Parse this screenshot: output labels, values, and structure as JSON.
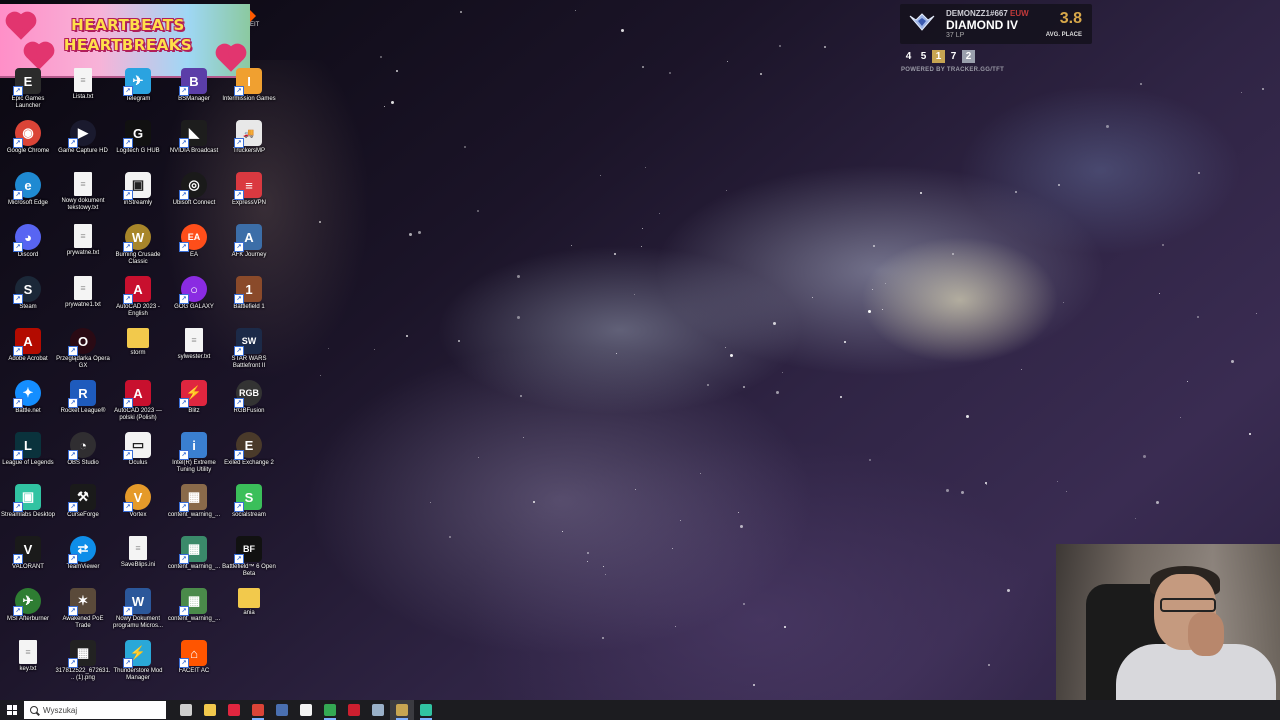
{
  "promo": {
    "line1": "HEARTBEATS",
    "line2": "HEARTBREAKS",
    "side_text": "EIT"
  },
  "desktop_icons": [
    {
      "label": "Epic Games Launcher",
      "color": "#2b2b2b",
      "glyph": "E",
      "kind": "app",
      "col": 0,
      "row": 0
    },
    {
      "label": "Lista.txt",
      "kind": "doc",
      "col": 1,
      "row": 0
    },
    {
      "label": "Telegram",
      "color": "#2aa3e0",
      "glyph": "✈",
      "kind": "app",
      "col": 2,
      "row": 0
    },
    {
      "label": "BSManager",
      "color": "#5b3ea8",
      "glyph": "B",
      "kind": "app",
      "col": 3,
      "row": 0
    },
    {
      "label": "Intermission Games",
      "color": "#f0a030",
      "glyph": "I",
      "kind": "app",
      "col": 4,
      "row": 0
    },
    {
      "label": "Google Chrome",
      "color": "#db4437",
      "glyph": "◉",
      "kind": "round",
      "col": 0,
      "row": 1
    },
    {
      "label": "Game Capture HD",
      "color": "#1a1a2e",
      "glyph": "▶",
      "kind": "round",
      "col": 1,
      "row": 1
    },
    {
      "label": "Logitech G HUB",
      "color": "#111",
      "glyph": "G",
      "kind": "app",
      "col": 2,
      "row": 1
    },
    {
      "label": "NVIDIA Broadcast",
      "color": "#1d1d1d",
      "glyph": "◣",
      "kind": "app",
      "col": 3,
      "row": 1
    },
    {
      "label": "TruckersMP",
      "color": "#e8e8e8",
      "glyph": "🚚",
      "kind": "app",
      "col": 4,
      "row": 1
    },
    {
      "label": "Microsoft Edge",
      "color": "#1f8ad2",
      "glyph": "e",
      "kind": "round",
      "col": 0,
      "row": 2
    },
    {
      "label": "Nowy dokument tekstowy.txt",
      "kind": "doc",
      "col": 1,
      "row": 2
    },
    {
      "label": "inStreamly",
      "color": "#f3f3f3",
      "glyph": "▣",
      "kind": "app",
      "col": 2,
      "row": 2
    },
    {
      "label": "Ubisoft Connect",
      "color": "#1a1a1a",
      "glyph": "◎",
      "kind": "round",
      "col": 3,
      "row": 2
    },
    {
      "label": "ExpressVPN",
      "color": "#da3940",
      "glyph": "≡",
      "kind": "app",
      "col": 4,
      "row": 2
    },
    {
      "label": "Discord",
      "color": "#5865f2",
      "glyph": "◕",
      "kind": "round",
      "col": 0,
      "row": 3
    },
    {
      "label": "prywatne.txt",
      "kind": "doc",
      "col": 1,
      "row": 3
    },
    {
      "label": "Burning Crusade Classic",
      "color": "#a8862a",
      "glyph": "W",
      "kind": "round",
      "col": 2,
      "row": 3
    },
    {
      "label": "EA",
      "color": "#ff4e1a",
      "glyph": "EA",
      "kind": "round",
      "col": 3,
      "row": 3
    },
    {
      "label": "AFK Journey",
      "color": "#3c6ea8",
      "glyph": "A",
      "kind": "app",
      "col": 4,
      "row": 3
    },
    {
      "label": "Steam",
      "color": "#1b2838",
      "glyph": "S",
      "kind": "round",
      "col": 0,
      "row": 4
    },
    {
      "label": "prywatne1.txt",
      "kind": "doc",
      "col": 1,
      "row": 4
    },
    {
      "label": "AutoCAD 2023 - English",
      "color": "#c8102e",
      "glyph": "A",
      "kind": "app",
      "col": 2,
      "row": 4
    },
    {
      "label": "GOG GALAXY",
      "color": "#8a2be2",
      "glyph": "○",
      "kind": "round",
      "col": 3,
      "row": 4
    },
    {
      "label": "Battlefield 1",
      "color": "#8a4a2a",
      "glyph": "1",
      "kind": "app",
      "col": 4,
      "row": 4
    },
    {
      "label": "Adobe Acrobat",
      "color": "#b30b00",
      "glyph": "A",
      "kind": "app",
      "col": 0,
      "row": 5
    },
    {
      "label": "Przeglądarka Opera GX",
      "color": "#2a0a14",
      "glyph": "O",
      "kind": "round",
      "col": 1,
      "row": 5
    },
    {
      "label": "storm",
      "kind": "folder",
      "col": 2,
      "row": 5
    },
    {
      "label": "sylwester.txt",
      "kind": "doc",
      "col": 3,
      "row": 5
    },
    {
      "label": "STAR WARS Battlefront II",
      "color": "#1c2a48",
      "glyph": "SW",
      "kind": "app",
      "col": 4,
      "row": 5
    },
    {
      "label": "Battle.net",
      "color": "#148eff",
      "glyph": "✦",
      "kind": "round",
      "col": 0,
      "row": 6
    },
    {
      "label": "Rocket League®",
      "color": "#1e5bbd",
      "glyph": "R",
      "kind": "app",
      "col": 1,
      "row": 6
    },
    {
      "label": "AutoCAD 2023 — polski (Polish)",
      "color": "#c8102e",
      "glyph": "A",
      "kind": "app",
      "col": 2,
      "row": 6
    },
    {
      "label": "Blitz",
      "color": "#e0263f",
      "glyph": "⚡",
      "kind": "app",
      "col": 3,
      "row": 6
    },
    {
      "label": "RGBFusion",
      "color": "#333",
      "glyph": "RGB",
      "kind": "round",
      "col": 4,
      "row": 6
    },
    {
      "label": "League of Legends",
      "color": "#0a323c",
      "glyph": "L",
      "kind": "app",
      "col": 0,
      "row": 7
    },
    {
      "label": "OBS Studio",
      "color": "#302e31",
      "glyph": "◔",
      "kind": "round",
      "col": 1,
      "row": 7
    },
    {
      "label": "Oculus",
      "color": "#f3f3f3",
      "glyph": "▭",
      "kind": "app",
      "col": 2,
      "row": 7
    },
    {
      "label": "Intel(R) Extreme Tuning Utility",
      "color": "#3a7fd0",
      "glyph": "i",
      "kind": "app",
      "col": 3,
      "row": 7
    },
    {
      "label": "Exiled Exchange 2",
      "color": "#4a3a2a",
      "glyph": "E",
      "kind": "round",
      "col": 4,
      "row": 7
    },
    {
      "label": "Streamlabs Desktop",
      "color": "#31c3a2",
      "glyph": "▣",
      "kind": "app",
      "col": 0,
      "row": 8
    },
    {
      "label": "CurseForge",
      "color": "#1a1a1a",
      "glyph": "⚒",
      "kind": "app",
      "col": 1,
      "row": 8
    },
    {
      "label": "Vortex",
      "color": "#e59a2a",
      "glyph": "V",
      "kind": "round",
      "col": 2,
      "row": 8
    },
    {
      "label": "content_warning_...",
      "color": "#8a6a4a",
      "glyph": "▦",
      "kind": "app",
      "col": 3,
      "row": 8
    },
    {
      "label": "socialstream",
      "color": "#3bbf5a",
      "glyph": "S",
      "kind": "app",
      "col": 4,
      "row": 8
    },
    {
      "label": "VALORANT",
      "color": "#1a1a1a",
      "glyph": "V",
      "kind": "app",
      "col": 0,
      "row": 9
    },
    {
      "label": "TeamViewer",
      "color": "#0e8ee9",
      "glyph": "⇄",
      "kind": "round",
      "col": 1,
      "row": 9
    },
    {
      "label": "SaveBlips.ini",
      "kind": "doc",
      "col": 2,
      "row": 9
    },
    {
      "label": "content_warning_...",
      "color": "#3a8a6a",
      "glyph": "▦",
      "kind": "app",
      "col": 3,
      "row": 9
    },
    {
      "label": "Battlefield™ 6 Open Beta",
      "color": "#111",
      "glyph": "BF",
      "kind": "app",
      "col": 4,
      "row": 9
    },
    {
      "label": "MSI Afterburner",
      "color": "#2e7d32",
      "glyph": "✈",
      "kind": "round",
      "col": 0,
      "row": 10
    },
    {
      "label": "Awakened PoE Trade",
      "color": "#5a4a3a",
      "glyph": "✶",
      "kind": "app",
      "col": 1,
      "row": 10
    },
    {
      "label": "Nowy Dokument programu Micros...",
      "color": "#2b579a",
      "glyph": "W",
      "kind": "app",
      "col": 2,
      "row": 10
    },
    {
      "label": "content_warning_...",
      "color": "#4a8a4a",
      "glyph": "▦",
      "kind": "app",
      "col": 3,
      "row": 10
    },
    {
      "label": "ania",
      "kind": "folder",
      "col": 4,
      "row": 10
    },
    {
      "label": "key.txt",
      "kind": "doc",
      "col": 0,
      "row": 11
    },
    {
      "label": "317812522_672631... (1).png",
      "color": "#222",
      "glyph": "▦",
      "kind": "app",
      "col": 1,
      "row": 11
    },
    {
      "label": "Thunderstore Mod Manager",
      "color": "#2aa8d8",
      "glyph": "⚡",
      "kind": "app",
      "col": 2,
      "row": 11
    },
    {
      "label": "FACEIT AC",
      "color": "#ff5500",
      "glyph": "⌂",
      "kind": "app",
      "col": 3,
      "row": 11
    }
  ],
  "rank_widget": {
    "player": "DEMONZZ1#667",
    "player_tag": "EUW",
    "tier": "DIAMOND IV",
    "lp": "37 LP",
    "avg_place": "3.8",
    "avg_label": "AVG. PLACE",
    "placements": [
      {
        "value": "4",
        "style": "plain"
      },
      {
        "value": "5",
        "style": "plain"
      },
      {
        "value": "1",
        "style": "gold"
      },
      {
        "value": "7",
        "style": "plain"
      },
      {
        "value": "2",
        "style": "silver"
      }
    ],
    "powered_by": "POWERED BY TRACKER.GG/TFT"
  },
  "taskbar": {
    "search_placeholder": "Wyszukaj",
    "icons": [
      {
        "name": "task-view-icon",
        "color": "#cfcfcf",
        "active": false
      },
      {
        "name": "file-explorer-icon",
        "color": "#f2c94c",
        "active": false
      },
      {
        "name": "opera-gx-icon",
        "color": "#e0263f",
        "active": false
      },
      {
        "name": "chrome-icon",
        "color": "#db4437",
        "active": true
      },
      {
        "name": "steam-icon",
        "color": "#4a6fb0",
        "active": false
      },
      {
        "name": "instreamly-icon",
        "color": "#f3f3f3",
        "active": false
      },
      {
        "name": "chrome-alt-icon",
        "color": "#34a853",
        "active": true
      },
      {
        "name": "opera-icon",
        "color": "#cc1f2f",
        "active": false
      },
      {
        "name": "window-icon",
        "color": "#9ab0c8",
        "active": false
      },
      {
        "name": "league-icon",
        "color": "#c7a552",
        "active": true
      },
      {
        "name": "streamlabs-icon",
        "color": "#31c3a2",
        "active": true
      }
    ]
  }
}
